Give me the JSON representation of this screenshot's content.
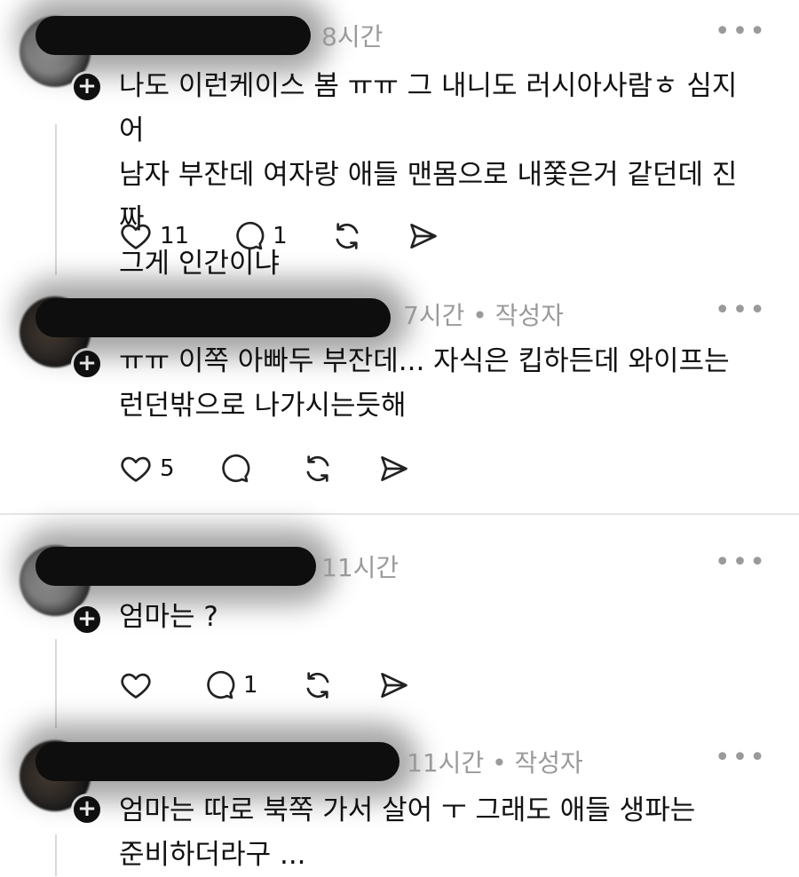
{
  "posts": [
    {
      "time": "8시간",
      "author_tag": "",
      "text_lines": [
        "나도 이런케이스 봄 ㅠㅠ 그 내니도 러시아사람ㅎ 심지어",
        "남자 부잔데 여자랑 애들 맨몸으로 내쫓은거 같던데 진짜",
        "그게 인간이냐"
      ],
      "likes": "11",
      "replies": "1"
    },
    {
      "time": "7시간",
      "author_tag": "• 작성자",
      "text_lines": [
        "ㅠㅠ 이쪽 아빠두 부잔데... 자식은 킵하든데 와이프는",
        "런던밖으로 나가시는듯해"
      ],
      "likes": "5",
      "replies": ""
    },
    {
      "time": "11시간",
      "author_tag": "",
      "text_lines": [
        "엄마는 ?"
      ],
      "likes": "",
      "replies": "1"
    },
    {
      "time": "11시간",
      "author_tag": "• 작성자",
      "text_lines": [
        "엄마는 따로 북쪽 가서 살어 ㅜ 그래도 애들 생파는",
        "준비하더라구 ..."
      ],
      "likes": "",
      "replies": ""
    }
  ],
  "icons": {
    "more": "more-icon",
    "like": "heart-icon",
    "reply": "comment-icon",
    "repost": "repost-icon",
    "share": "send-icon",
    "follow": "plus-icon"
  },
  "more_glyph": "•••",
  "plus_glyph": "+"
}
